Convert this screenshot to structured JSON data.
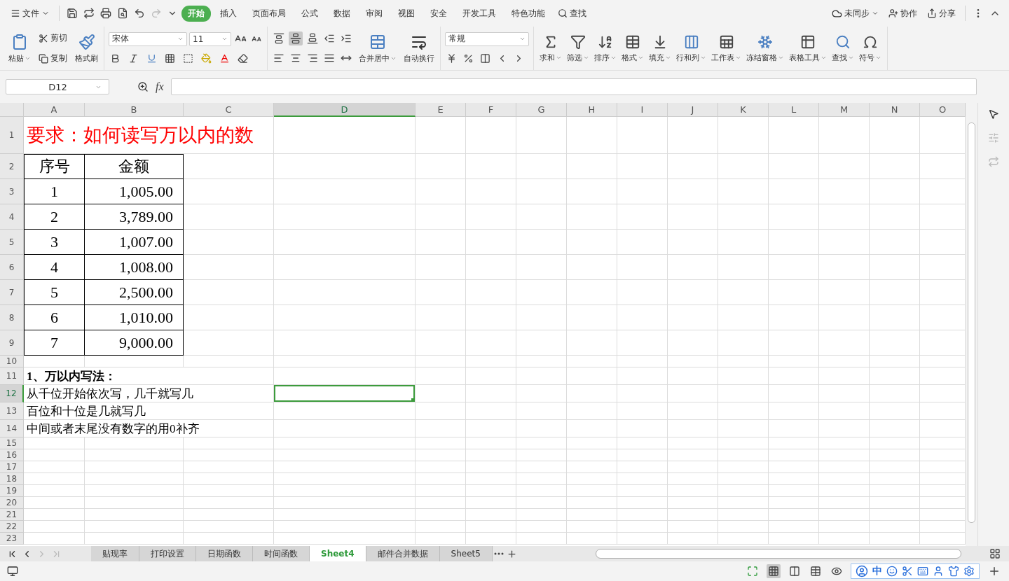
{
  "menu": {
    "file": "文件",
    "tabs": [
      {
        "label": "开始",
        "selected": true
      },
      {
        "label": "插入",
        "selected": false
      },
      {
        "label": "页面布局",
        "selected": false
      },
      {
        "label": "公式",
        "selected": false
      },
      {
        "label": "数据",
        "selected": false
      },
      {
        "label": "审阅",
        "selected": false
      },
      {
        "label": "视图",
        "selected": false
      },
      {
        "label": "安全",
        "selected": false
      },
      {
        "label": "开发工具",
        "selected": false
      },
      {
        "label": "特色功能",
        "selected": false
      }
    ],
    "search": "查找",
    "sync": "未同步",
    "collab": "协作",
    "share": "分享"
  },
  "ribbon": {
    "paste": "粘贴",
    "cut": "剪切",
    "copy": "复制",
    "format_painter": "格式刷",
    "font_name": "宋体",
    "font_size": "11",
    "alignment": [
      {
        "selected": false
      },
      {
        "selected": true
      },
      {
        "selected": false
      },
      {
        "selected": false
      },
      {
        "selected": false
      },
      {
        "selected": false
      },
      {
        "selected": false
      },
      {
        "selected": false
      },
      {
        "selected": false
      },
      {
        "selected": false
      }
    ],
    "merge": "合并居中",
    "wrap": "自动换行",
    "number_format": "常规",
    "tools": [
      "求和",
      "筛选",
      "排序",
      "格式",
      "填充",
      "行和列",
      "工作表",
      "冻结窗格",
      "表格工具",
      "查找",
      "符号"
    ]
  },
  "formula_bar": {
    "name_box": "D12",
    "fx": "fx"
  },
  "ime": "中",
  "sheet": {
    "columns": [
      {
        "label": "A",
        "selected": false
      },
      {
        "label": "B",
        "selected": false
      },
      {
        "label": "C",
        "selected": false
      },
      {
        "label": "D",
        "selected": true
      },
      {
        "label": "E",
        "selected": false
      },
      {
        "label": "F",
        "selected": false
      },
      {
        "label": "G",
        "selected": false
      },
      {
        "label": "H",
        "selected": false
      },
      {
        "label": "I",
        "selected": false
      },
      {
        "label": "J",
        "selected": false
      },
      {
        "label": "K",
        "selected": false
      },
      {
        "label": "L",
        "selected": false
      },
      {
        "label": "M",
        "selected": false
      },
      {
        "label": "N",
        "selected": false
      },
      {
        "label": "O",
        "selected": false
      }
    ],
    "rows": [
      {
        "label": "1",
        "selected": false,
        "kind": "title",
        "text": "要求：如何读写万以内的数"
      },
      {
        "label": "2",
        "selected": false,
        "kind": "table",
        "cells": [
          "序号",
          "金额"
        ]
      },
      {
        "label": "3",
        "selected": false,
        "kind": "table",
        "cells": [
          "1",
          "1,005.00"
        ]
      },
      {
        "label": "4",
        "selected": false,
        "kind": "table",
        "cells": [
          "2",
          "3,789.00"
        ]
      },
      {
        "label": "5",
        "selected": false,
        "kind": "table",
        "cells": [
          "3",
          "1,007.00"
        ]
      },
      {
        "label": "6",
        "selected": false,
        "kind": "table",
        "cells": [
          "4",
          "1,008.00"
        ]
      },
      {
        "label": "7",
        "selected": false,
        "kind": "table",
        "cells": [
          "5",
          "2,500.00"
        ]
      },
      {
        "label": "8",
        "selected": false,
        "kind": "table",
        "cells": [
          "6",
          "1,010.00"
        ]
      },
      {
        "label": "9",
        "selected": false,
        "kind": "table",
        "cells": [
          "7",
          "9,000.00"
        ]
      },
      {
        "label": "10",
        "selected": false,
        "kind": "empty"
      },
      {
        "label": "11",
        "selected": false,
        "kind": "note",
        "bold": true,
        "text": "1、万以内写法："
      },
      {
        "label": "12",
        "selected": true,
        "kind": "note",
        "bold": false,
        "text": "从千位开始依次写，几千就写几"
      },
      {
        "label": "13",
        "selected": false,
        "kind": "note",
        "bold": false,
        "text": "百位和十位是几就写几"
      },
      {
        "label": "14",
        "selected": false,
        "kind": "note",
        "bold": false,
        "text": "中间或者末尾没有数字的用0补齐"
      },
      {
        "label": "15",
        "selected": false,
        "kind": "empty"
      },
      {
        "label": "16",
        "selected": false,
        "kind": "empty"
      },
      {
        "label": "17",
        "selected": false,
        "kind": "empty"
      },
      {
        "label": "18",
        "selected": false,
        "kind": "empty"
      },
      {
        "label": "19",
        "selected": false,
        "kind": "empty"
      },
      {
        "label": "20",
        "selected": false,
        "kind": "empty"
      },
      {
        "label": "21",
        "selected": false,
        "kind": "empty"
      },
      {
        "label": "22",
        "selected": false,
        "kind": "empty"
      },
      {
        "label": "23",
        "selected": false,
        "kind": "empty"
      }
    ]
  },
  "sheet_tabs": [
    {
      "label": "贴现率",
      "selected": false
    },
    {
      "label": "打印设置",
      "selected": false
    },
    {
      "label": "日期函数",
      "selected": false
    },
    {
      "label": "时间函数",
      "selected": false
    },
    {
      "label": "Sheet4",
      "selected": true
    },
    {
      "label": "邮件合并数据",
      "selected": false
    },
    {
      "label": "Sheet5",
      "selected": false
    }
  ]
}
